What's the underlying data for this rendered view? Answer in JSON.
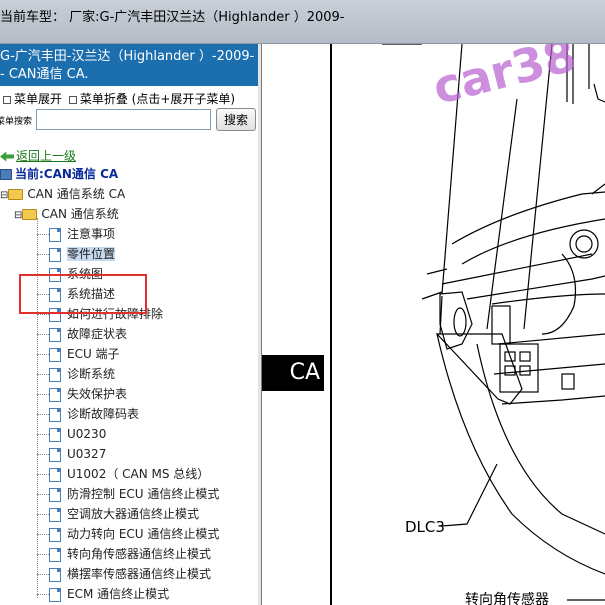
{
  "topbar": {
    "title": "当前车型：  厂家:G-广汽丰田汉兰达（Highlander ）2009-"
  },
  "sidebar": {
    "header_line1": "G-广汽丰田-汉兰达（Highlander ）-2009-",
    "header_line2": "- CAN通信 CA.",
    "expand_label": "菜单展开",
    "collapse_label": "菜单折叠 (点击+展开子菜单)",
    "search_label": "菜单搜索",
    "search_value": "",
    "search_button": "搜索",
    "back_label": "返回上一级",
    "current_label": "当前:CAN通信 CA",
    "folder1": "CAN 通信系统 CA",
    "folder2": "CAN 通信系统",
    "items": [
      "注意事项",
      "零件位置",
      "系统图",
      "系统描述",
      "如何进行故障排除",
      "故障症状表",
      "ECU 端子",
      "诊断系统",
      "失效保护表",
      "诊断故障码表",
      "U0230",
      "U0327",
      "U1002（ CAN MS 总线）",
      "防滑控制 ECU 通信终止模式",
      "空调放大器通信终止模式",
      "动力转向 ECU 通信终止模式",
      "转向角传感器通信终止模式",
      "横摆率传感器通信终止模式",
      "ECM 通信终止模式"
    ],
    "selected_index": 1
  },
  "diagram": {
    "section_tag": "CA",
    "label_dlc": "DLC3",
    "label_sensor": "转向角传感器",
    "watermark": "car38"
  }
}
